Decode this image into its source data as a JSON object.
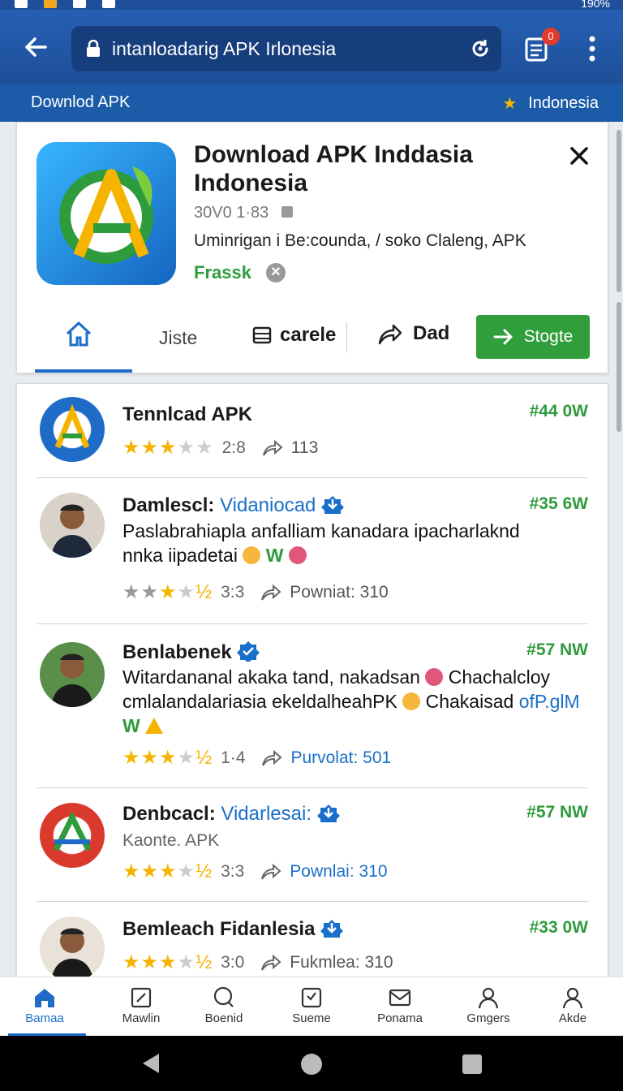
{
  "status_bar": {
    "battery": "190%"
  },
  "browser": {
    "url": "intanloadarig APK Irlonesia",
    "tab_count": "0"
  },
  "subbar": {
    "left": "Downlod APK",
    "right": "Indonesia"
  },
  "app": {
    "title": "Download APK Inddasia Indonesia",
    "meta": "30V0 1·83",
    "description": "Uminrigan i Be:counda, / soko Claleng, APK",
    "price_label": "Frassk"
  },
  "tabs": {
    "jiste": "Jiste",
    "carele": "carele",
    "dad": "Dad",
    "action": "Stogte"
  },
  "list": [
    {
      "name": "Tennlcad APK",
      "price": "#44 0W",
      "rating": "2:8",
      "downloads": "113",
      "stars": 3
    },
    {
      "name": "Damlescl:",
      "name_suffix": "Vidaniocad",
      "price": "#35 6W",
      "text_line1": "Paslabrahiapla anfalliam kanadara ipacharlaknd",
      "text_line2": "nnka iipadetai",
      "text_tag": "W",
      "rating": "3:3",
      "downloads": "Powniat: 310",
      "stars": 3.5
    },
    {
      "name": "Benlabenek",
      "price": "#57 NW",
      "text_line1": "Witardananal akaka tand, nakadsan",
      "text_line1b": "Chachalcloy",
      "text_line2": "cmlalandalariasia ekeldalheahPK",
      "text_line2b": "Chakaisad",
      "text_link": "ofP.glM",
      "text_tag": "W",
      "rating": "1·4",
      "downloads": "Purvolat: 501",
      "stars": 3.5
    },
    {
      "name": "Denbcacl:",
      "name_suffix": "Vidarlesai:",
      "price": "#57 NW",
      "text_line1": "Kaonte. APK",
      "rating": "3:3",
      "downloads": "Pownlai: 310",
      "stars": 3.5
    },
    {
      "name": "Bemleach Fidanlesia",
      "price": "#33 0W",
      "rating": "3:0",
      "downloads": "Fukmlea: 310",
      "stars": 3.5
    }
  ],
  "bottom_nav": [
    "Bamaa",
    "Mawlin",
    "Boenid",
    "Sueme",
    "Ponama",
    "Gmgers",
    "Akde"
  ],
  "colors": {
    "primary": "#1d4f99",
    "accent_green": "#2f9e3b",
    "link_blue": "#1a6fc9",
    "star": "#f4b400"
  }
}
